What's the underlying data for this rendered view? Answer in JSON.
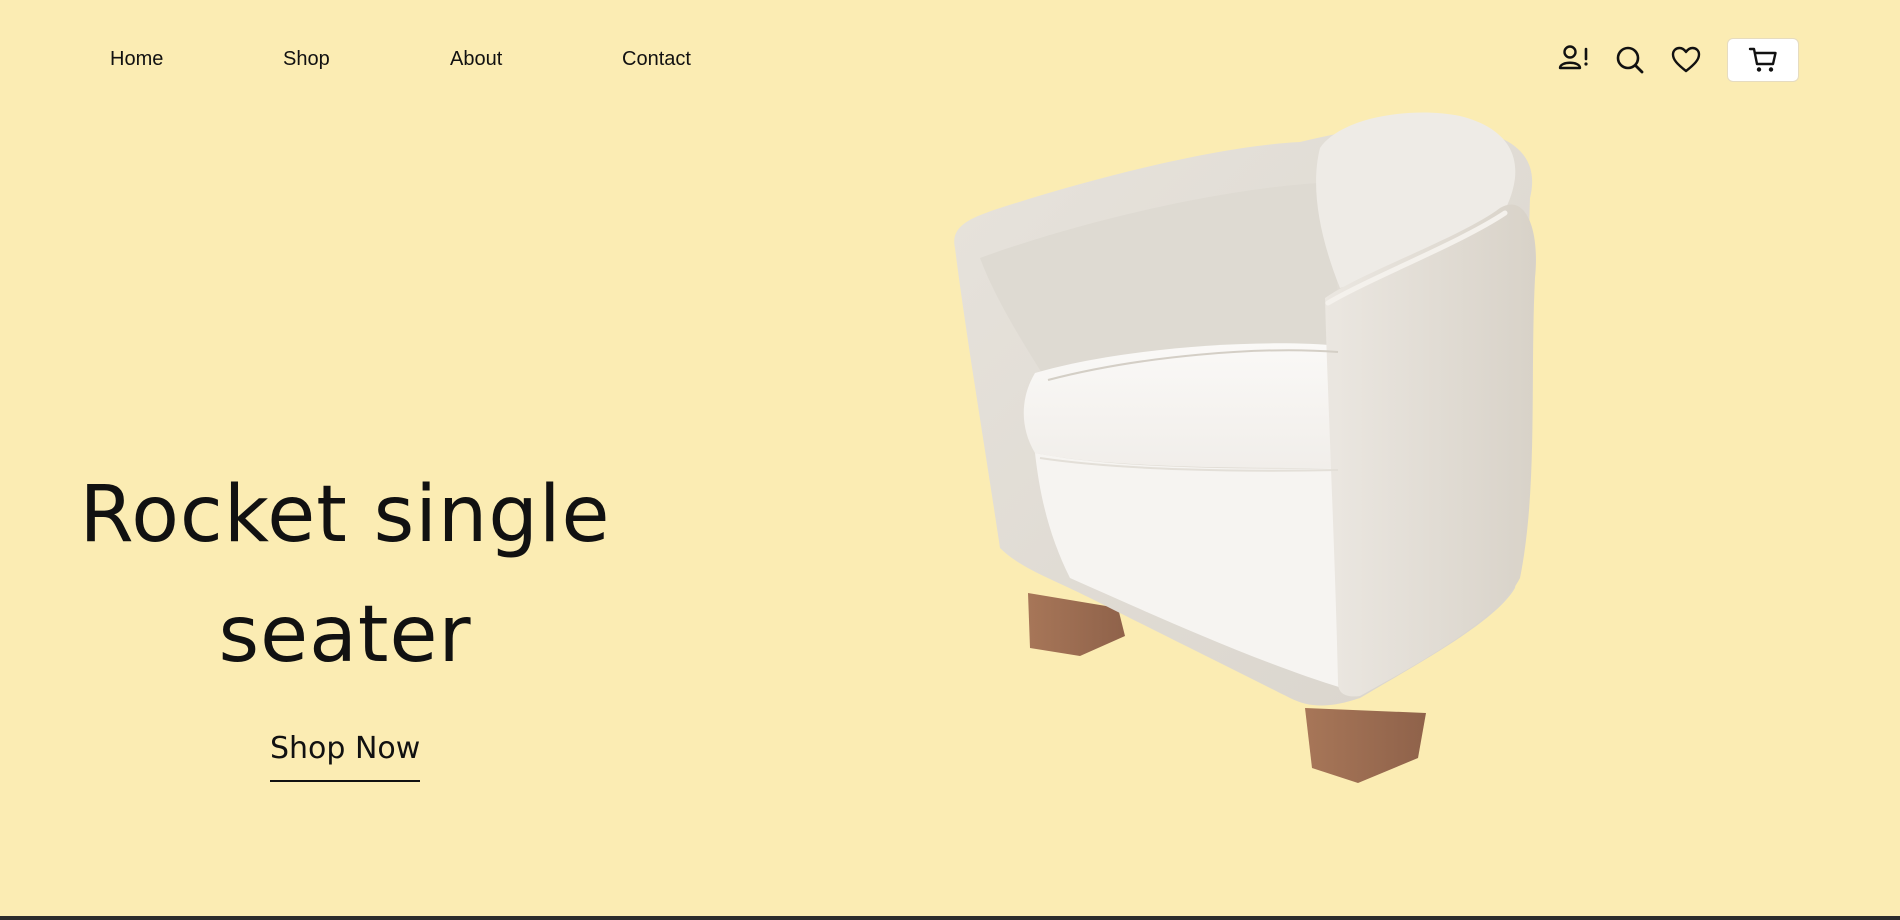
{
  "nav": {
    "links": [
      "Home",
      "Shop",
      "About",
      "Contact"
    ]
  },
  "header_icons": [
    "account-icon",
    "search-icon",
    "heart-icon",
    "cart-icon"
  ],
  "hero": {
    "title_line1": "Rocket single",
    "title_line2": "seater",
    "cta_label": "Shop Now",
    "image": "white-armchair"
  },
  "colors": {
    "background": "#fbecb3",
    "text": "#111111",
    "cart_button_bg": "#ffffff"
  }
}
